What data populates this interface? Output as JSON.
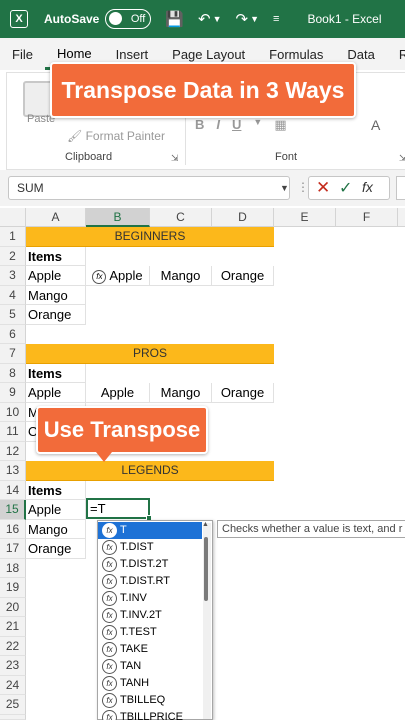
{
  "titlebar": {
    "autosave_label": "AutoSave",
    "autosave_state": "Off",
    "doc_title": "Book1 - Excel"
  },
  "ribbon_tabs": [
    "File",
    "Home",
    "Insert",
    "Page Layout",
    "Formulas",
    "Data",
    "Rev"
  ],
  "ribbon": {
    "paste_label": "Paste",
    "format_painter": "Format Painter",
    "clipboard_group": "Clipboard",
    "font_group": "Font",
    "bold": "B",
    "italic": "I",
    "underline": "U",
    "font_color": "A"
  },
  "overlay_banner": "Transpose Data in 3 Ways",
  "formula_bar": {
    "name_box": "SUM",
    "fx_label": "fx"
  },
  "columns": [
    "A",
    "B",
    "C",
    "D",
    "E",
    "F"
  ],
  "rows": {
    "r1": "BEGINNERS",
    "r2a": "Items",
    "r3a": "Apple",
    "r3b": "Apple",
    "r3c": "Mango",
    "r3d": "Orange",
    "r4a": "Mango",
    "r5a": "Orange",
    "r7": "PROS",
    "r8a": "Items",
    "r9a": "Apple",
    "r9b": "Apple",
    "r9c": "Mango",
    "r9d": "Orange",
    "r10a": "M",
    "r11a": "O",
    "r13": "LEGENDS",
    "r14a": "Items",
    "r15a": "Apple",
    "r16a": "Mango",
    "r17a": "Orange"
  },
  "active_cell_value": "=T",
  "callout": "Use Transpose",
  "autocomplete": {
    "items": [
      "T",
      "T.DIST",
      "T.DIST.2T",
      "T.DIST.RT",
      "T.INV",
      "T.INV.2T",
      "T.TEST",
      "TAKE",
      "TAN",
      "TANH",
      "TBILLEQ",
      "TBILLPRICE"
    ],
    "tooltip": "Checks whether a value is text, and r"
  }
}
